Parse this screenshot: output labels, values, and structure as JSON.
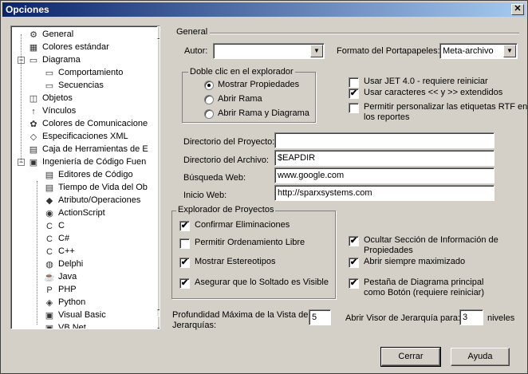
{
  "window": {
    "title": "Opciones"
  },
  "tree": {
    "items": [
      {
        "label": "General",
        "icon": "general-icon"
      },
      {
        "label": "Colores estándar",
        "icon": "colors-icon"
      },
      {
        "label": "Diagrama",
        "icon": "page-icon"
      },
      {
        "label": "Comportamiento",
        "icon": "page-icon"
      },
      {
        "label": "Secuencias",
        "icon": "page-icon"
      },
      {
        "label": "Objetos",
        "icon": "object-icon"
      },
      {
        "label": "Vínculos",
        "icon": "link-icon"
      },
      {
        "label": "Colores de Comunicacione",
        "icon": "palette-icon"
      },
      {
        "label": "Especificaciones XML",
        "icon": "xml-icon"
      },
      {
        "label": "Caja de Herramientas de E",
        "icon": "toolbox-icon"
      },
      {
        "label": "Ingeniería de Código Fuen",
        "icon": "code-engineering-icon"
      },
      {
        "label": "Editores de Código",
        "icon": "editor-icon"
      },
      {
        "label": "Tiempo de Vida del Ob",
        "icon": "lifetime-icon"
      },
      {
        "label": "Atributo/Operaciones",
        "icon": "attribute-icon"
      },
      {
        "label": "ActionScript",
        "icon": "actionscript-icon"
      },
      {
        "label": "C",
        "icon": "c-icon"
      },
      {
        "label": "C#",
        "icon": "csharp-icon"
      },
      {
        "label": "C++",
        "icon": "cpp-icon"
      },
      {
        "label": "Delphi",
        "icon": "delphi-icon"
      },
      {
        "label": "Java",
        "icon": "java-icon"
      },
      {
        "label": "PHP",
        "icon": "php-icon"
      },
      {
        "label": "Python",
        "icon": "python-icon"
      },
      {
        "label": "Visual Basic",
        "icon": "vb-icon"
      },
      {
        "label": "VB.Net",
        "icon": "vbnet-icon"
      }
    ],
    "expanders": [
      "−",
      "−",
      "−"
    ]
  },
  "general": {
    "group_title": "General",
    "author_label": "Autor:",
    "author_value": "",
    "clipboard_label": "Formato del Portapapeles:",
    "clipboard_value": "Meta-archivo",
    "dblclick_group": "Doble clic en el explorador",
    "radio_options": [
      "Mostrar Propiedades",
      "Abrir Rama",
      "Abrir Rama y Diagrama"
    ],
    "radio_selected": "Mostrar Propiedades",
    "checks_top": [
      {
        "label": "Usar JET 4.0 - requiere reiniciar",
        "checked": false
      },
      {
        "label": "Usar caracteres << y >> extendidos",
        "checked": true
      },
      {
        "label": "Permitir personalizar las etiquetas RTF en",
        "label2": "los reportes",
        "checked": false
      }
    ],
    "project_dir_label": "Directorio del Proyecto:",
    "project_dir_value": "",
    "file_dir_label": "Directorio del Archivo:",
    "file_dir_value": "$EAPDIR",
    "web_search_label": "Búsqueda Web:",
    "web_search_value": "www.google.com",
    "web_home_label": "Inicio Web:",
    "web_home_value": "http://sparxsystems.com"
  },
  "explorer": {
    "group_title": "Explorador de Proyectos",
    "checks": [
      {
        "label": "Confirmar Eliminaciones",
        "checked": true
      },
      {
        "label": "Permitir Ordenamiento Libre",
        "checked": false
      },
      {
        "label": "Mostrar Estereotipos",
        "checked": true
      },
      {
        "label": "Asegurar que lo Soltado es Visible",
        "checked": true
      }
    ],
    "right_checks": [
      {
        "label": "Ocultar Sección de Información de",
        "label2": "Propiedades",
        "checked": true
      },
      {
        "label": "Abrir siempre maximizado",
        "checked": true
      },
      {
        "label": "Pestaña de Diagrama principal",
        "label2": "como Botón (requiere reiniciar)",
        "checked": true
      }
    ]
  },
  "depth": {
    "label1": "Profundidad Máxima de la Vista de",
    "label2": "Jerarquías:",
    "value": "5",
    "viewer_label": "Abrir Visor de Jerarquía para:",
    "viewer_value": "3",
    "viewer_suffix": "niveles"
  },
  "buttons": {
    "close": "Cerrar",
    "help": "Ayuda"
  },
  "glyphs": {
    "check": "✔",
    "down_arrow": "▼",
    "up_arrow": "▲",
    "close": "✕"
  }
}
